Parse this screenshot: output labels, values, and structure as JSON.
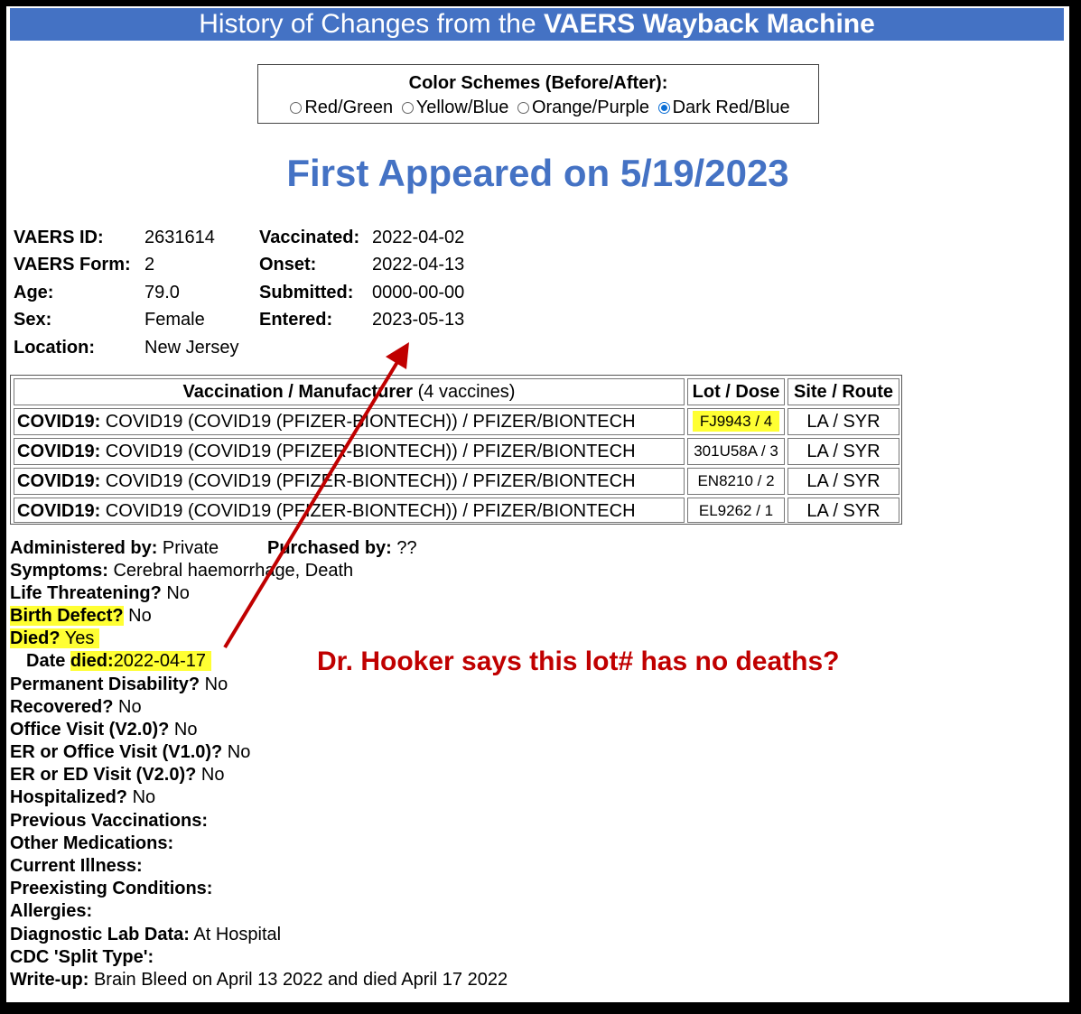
{
  "header": {
    "title_prefix": "History of Changes from the ",
    "title_bold": "VAERS Wayback Machine"
  },
  "color_schemes": {
    "title": "Color Schemes (Before/After):",
    "options": [
      {
        "label": "Red/Green",
        "selected": false
      },
      {
        "label": "Yellow/Blue",
        "selected": false
      },
      {
        "label": "Orange/Purple",
        "selected": false
      },
      {
        "label": "Dark Red/Blue",
        "selected": true
      }
    ]
  },
  "headline": "First Appeared on 5/19/2023",
  "report": {
    "left": [
      {
        "label": "VAERS ID:",
        "value": "2631614"
      },
      {
        "label": "VAERS Form:",
        "value": "2"
      },
      {
        "label": "Age:",
        "value": "79.0"
      },
      {
        "label": "Sex:",
        "value": "Female"
      },
      {
        "label": "Location:",
        "value": "New Jersey"
      }
    ],
    "right": [
      {
        "label": "Vaccinated:",
        "value": "2022-04-02"
      },
      {
        "label": "Onset:",
        "value": "2022-04-13"
      },
      {
        "label": "Submitted:",
        "value": "0000-00-00"
      },
      {
        "label": "Entered:",
        "value": "2023-05-13"
      }
    ]
  },
  "vaccinations": {
    "headers": {
      "vaccination_bold": "Vaccination / Manufacturer",
      "vaccination_count": " (4 vaccines)",
      "lot_dose": "Lot / Dose",
      "site_route": "Site / Route"
    },
    "rows": [
      {
        "type": "COVID19:",
        "description": " COVID19 (COVID19 (PFIZER-BIONTECH)) / PFIZER/BIONTECH",
        "lot_dose": "FJ9943 / 4",
        "site_route": "LA / SYR",
        "highlight": true
      },
      {
        "type": "COVID19:",
        "description": " COVID19 (COVID19 (PFIZER-BIONTECH)) / PFIZER/BIONTECH",
        "lot_dose": "301U58A / 3",
        "site_route": "LA / SYR",
        "highlight": false
      },
      {
        "type": "COVID19:",
        "description": " COVID19 (COVID19 (PFIZER-BIONTECH)) / PFIZER/BIONTECH",
        "lot_dose": "EN8210 / 2",
        "site_route": "LA / SYR",
        "highlight": false
      },
      {
        "type": "COVID19:",
        "description": " COVID19 (COVID19 (PFIZER-BIONTECH)) / PFIZER/BIONTECH",
        "lot_dose": "EL9262 / 1",
        "site_route": "LA / SYR",
        "highlight": false
      }
    ]
  },
  "details": {
    "administered_label": "Administered by:",
    "administered_value": " Private",
    "purchased_label": "Purchased by:",
    "purchased_value": " ??",
    "symptoms_label": "Symptoms:",
    "symptoms_value": " Cerebral haemorrhage, Death",
    "life_label": "Life Threatening?",
    "life_value": " No",
    "birth_label": "Birth Defect?",
    "birth_value": " No",
    "died_label": "Died?",
    "died_value": " Yes",
    "date_died_label_1": "Date ",
    "date_died_label_2": "died:",
    "date_died_value": "2022-04-17",
    "perm_label": "Permanent Disability?",
    "perm_value": " No",
    "recovered_label": "Recovered?",
    "recovered_value": " No",
    "office_label": "Office Visit (V2.0)?",
    "office_value": " No",
    "er_office_label": "ER or Office Visit (V1.0)?",
    "er_office_value": " No",
    "er_ed_label": "ER or ED Visit (V2.0)?",
    "er_ed_value": " No",
    "hosp_label": "Hospitalized?",
    "hosp_value": " No",
    "prev_label": "Previous Vaccinations:",
    "meds_label": "Other Medications:",
    "illness_label": "Current Illness:",
    "preexisting_label": "Preexisting Conditions:",
    "allergies_label": "Allergies:",
    "lab_label": "Diagnostic Lab Data:",
    "lab_value": " At Hospital",
    "split_label": "CDC 'Split Type':",
    "writeup_label": "Write-up:",
    "writeup_value": " Brain Bleed on April 13 2022 and died April 17 2022"
  },
  "annotation": {
    "text": "Dr. Hooker says this lot# has no deaths?",
    "color": "#c00000"
  },
  "colors": {
    "header_blue": "#4472c4",
    "highlight_yellow": "#ffff33",
    "arrow_red": "#c00000"
  }
}
